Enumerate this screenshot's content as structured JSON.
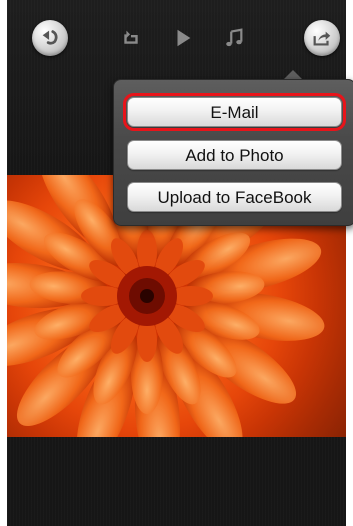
{
  "toolbar": {
    "back": {
      "icon": "back-arrow-icon"
    },
    "repeat": {
      "icon": "repeat-icon"
    },
    "play": {
      "icon": "play-icon"
    },
    "music": {
      "icon": "music-note-icon"
    },
    "share": {
      "icon": "share-icon"
    }
  },
  "share_menu": {
    "items": [
      {
        "label": "E-Mail",
        "selected": true
      },
      {
        "label": "Add to Photo",
        "selected": false
      },
      {
        "label": "Upload to FaceBook",
        "selected": false
      }
    ]
  },
  "photo": {
    "subject": "orange-chrysanthemum-photo"
  },
  "colors": {
    "highlight": "#e8141a",
    "popup_bg": "#4a4a4a",
    "screen_bg": "#161616"
  }
}
